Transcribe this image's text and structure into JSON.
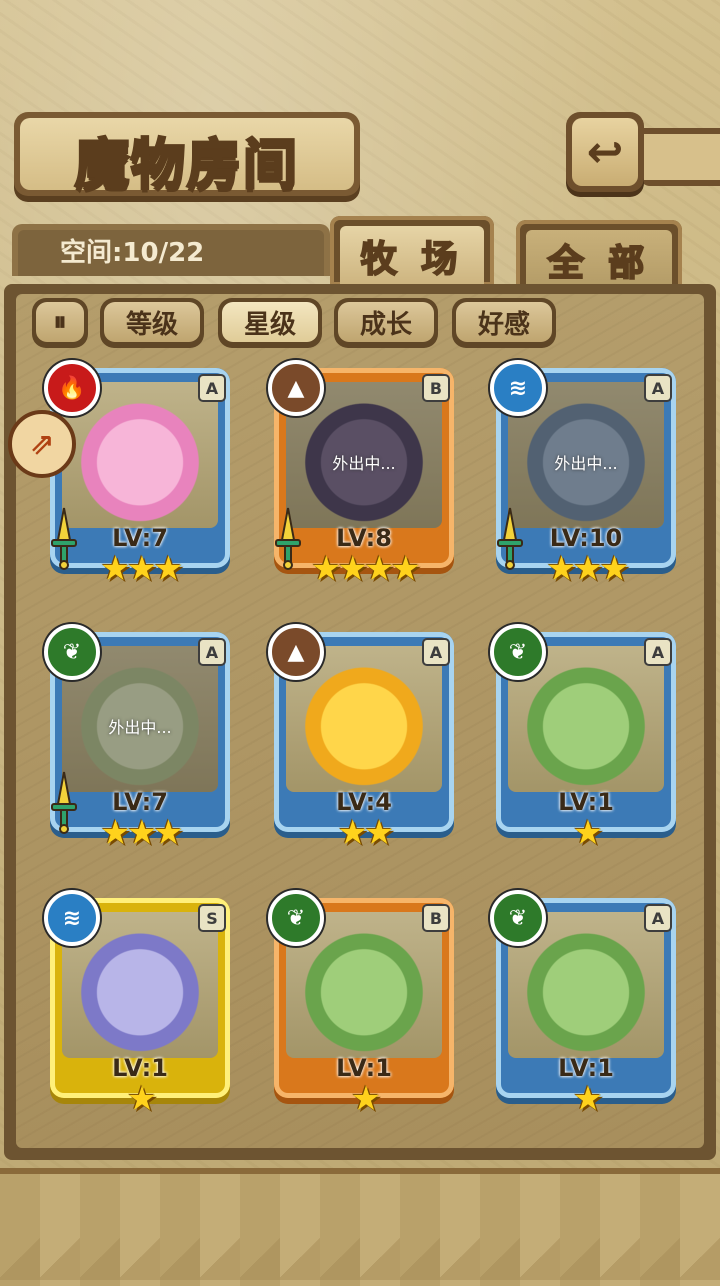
{
  "header": {
    "title": "魔物房间",
    "back_icon": "return-arrow-icon"
  },
  "capacity": {
    "text": "空间:10/22"
  },
  "tabs": [
    {
      "label": "牧 场",
      "active": true
    },
    {
      "label": "全 部",
      "active": false
    }
  ],
  "sort": {
    "toggle_icon": "sort-order-icon",
    "buttons": [
      {
        "label": "等级",
        "active": false
      },
      {
        "label": "星级",
        "active": true
      },
      {
        "label": "成长",
        "active": false
      },
      {
        "label": "好感",
        "active": false
      }
    ]
  },
  "colors": {
    "fire": "#c81a1a",
    "earth": "#7a4a2a",
    "water": "#2a7fc4",
    "grass": "#2e7a2a",
    "frame_blue": "#3c7ab6",
    "frame_orange": "#d9781c",
    "frame_yellow": "#d9b30c"
  },
  "monsters": [
    {
      "element": "fire-icon",
      "grade": "A",
      "level": "LV:7",
      "stars": "★★★",
      "status": "",
      "frame": "blue",
      "sword": true
    },
    {
      "element": "earth-icon",
      "grade": "B",
      "level": "LV:8",
      "stars": "★★★★",
      "status": "外出中...",
      "frame": "orange",
      "sword": true
    },
    {
      "element": "water-icon",
      "grade": "A",
      "level": "LV:10",
      "stars": "★★★",
      "status": "外出中...",
      "frame": "blue",
      "sword": true
    },
    {
      "element": "grass-icon",
      "grade": "A",
      "level": "LV:7",
      "stars": "★★★",
      "status": "外出中...",
      "frame": "blue",
      "sword": true
    },
    {
      "element": "earth-icon",
      "grade": "A",
      "level": "LV:4",
      "stars": "★★",
      "status": "",
      "frame": "blue",
      "sword": false
    },
    {
      "element": "grass-icon",
      "grade": "A",
      "level": "LV:1",
      "stars": "★",
      "status": "",
      "frame": "blue",
      "sword": false
    },
    {
      "element": "water-icon",
      "grade": "S",
      "level": "LV:1",
      "stars": "★",
      "status": "",
      "frame": "yellow",
      "sword": false
    },
    {
      "element": "grass-icon",
      "grade": "B",
      "level": "LV:1",
      "stars": "★",
      "status": "",
      "frame": "orange",
      "sword": false
    },
    {
      "element": "grass-icon",
      "grade": "A",
      "level": "LV:1",
      "stars": "★",
      "status": "",
      "frame": "blue",
      "sword": false
    }
  ]
}
